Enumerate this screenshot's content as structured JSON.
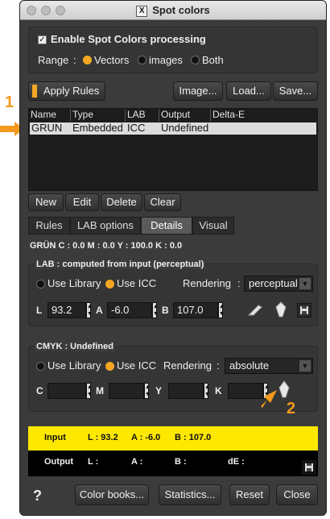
{
  "window": {
    "title": "Spot colors"
  },
  "spot": {
    "enable_label": "Enable Spot Colors processing",
    "range_label": "Range",
    "range_sep": ":",
    "range_options": [
      "Vectors",
      "images",
      "Both"
    ]
  },
  "toolbar": {
    "apply": "Apply Rules",
    "image": "Image...",
    "load": "Load...",
    "save": "Save..."
  },
  "table": {
    "headers": [
      "Name",
      "Type",
      "LAB",
      "Output",
      "Delta-E"
    ],
    "row": [
      "GRUN",
      "Embedded",
      "ICC",
      "Undefined",
      ""
    ]
  },
  "row_buttons": [
    "New",
    "Edit",
    "Delete",
    "Clear"
  ],
  "tabs": [
    "Rules",
    "LAB options",
    "Details",
    "Visual"
  ],
  "summary": "GRÜN  C : 0.0   M : 0.0   Y : 100.0   K : 0.0",
  "lab": {
    "title": "LAB : computed from input (perceptual)",
    "use_library": "Use Library",
    "use_icc": "Use ICC",
    "rendering_label": "Rendering",
    "rendering_sep": ":",
    "rendering_value": "perceptual",
    "L_label": "L",
    "L_value": "93.2",
    "A_label": "A",
    "A_value": "-6.0",
    "B_label": "B",
    "B_value": "107.0"
  },
  "cmyk": {
    "title": "CMYK : Undefined",
    "use_library": "Use Library",
    "use_icc": "Use ICC",
    "rendering_label": "Rendering",
    "rendering_sep": ":",
    "rendering_value": "absolute",
    "C_label": "C",
    "M_label": "M",
    "Y_label": "Y",
    "K_label": "K"
  },
  "preview": {
    "input_label": "Input",
    "input_L": "L : 93.2",
    "input_A": "A : -6.0",
    "input_B": "B : 107.0",
    "output_label": "Output",
    "output_L": "L :",
    "output_A": "A :",
    "output_B": "B :",
    "output_dE": "dE :",
    "input_color": "#ffe800"
  },
  "footer": {
    "help": "?",
    "color_books": "Color books...",
    "statistics": "Statistics...",
    "reset": "Reset",
    "close": "Close"
  },
  "annotations": {
    "one": "1",
    "two": "2"
  },
  "colors": {
    "accent": "#f5a623",
    "panel": "#3b3b3b"
  }
}
